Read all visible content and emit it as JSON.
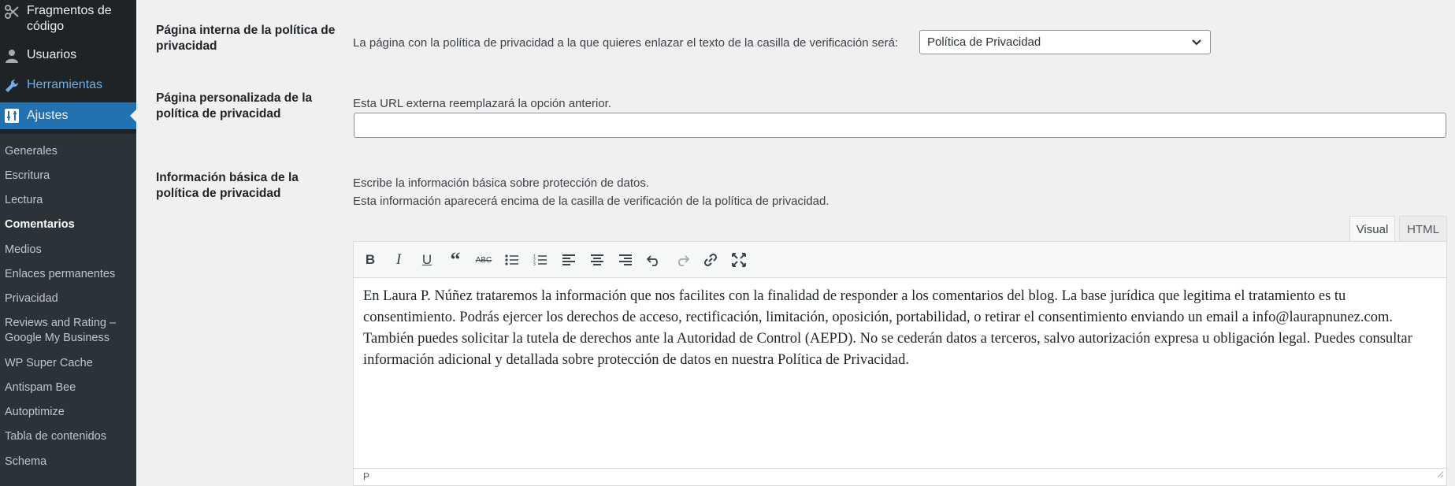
{
  "sidebar": {
    "menu": [
      {
        "label": "Fragmentos de código",
        "icon": "scissors-icon"
      },
      {
        "label": "Usuarios",
        "icon": "user-icon"
      },
      {
        "label": "Herramientas",
        "icon": "wrench-icon"
      },
      {
        "label": "Ajustes",
        "icon": "settings-icon"
      }
    ],
    "submenu": [
      "Generales",
      "Escritura",
      "Lectura",
      "Comentarios",
      "Medios",
      "Enlaces permanentes",
      "Privacidad",
      "Reviews and Rating – Google My Business",
      "WP Super Cache",
      "Antispam Bee",
      "Autoptimize",
      "Tabla de contenidos",
      "Schema"
    ]
  },
  "settings": {
    "internal_page": {
      "label": "Página interna de la política de privacidad",
      "description": "La página con la política de privacidad a la que quieres enlazar el texto de la casilla de verificación será:",
      "selected": "Política de Privacidad"
    },
    "custom_page": {
      "label": "Página personalizada de la política de privacidad",
      "description": "Esta URL externa reemplazará la opción anterior.",
      "value": ""
    },
    "basic_info": {
      "label": "Información básica de la política de privacidad",
      "description_1": "Escribe la información básica sobre protección de datos.",
      "description_2": "Esta información aparecerá encima de la casilla de verificación de la política de privacidad."
    }
  },
  "editor": {
    "tabs": [
      "Visual",
      "HTML"
    ],
    "active_tab": "Visual",
    "toolbar": [
      "bold-icon",
      "italic-icon",
      "underline-icon",
      "blockquote-icon",
      "strikethrough-icon",
      "bullet-list-icon",
      "numbered-list-icon",
      "align-left-icon",
      "align-center-icon",
      "align-right-icon",
      "undo-icon",
      "redo-icon",
      "link-icon",
      "fullscreen-icon"
    ],
    "content": "En Laura P. Núñez trataremos la información que nos facilites con la finalidad de responder a los comentarios del blog. La base jurídica que legitima el tratamiento es tu consentimiento. Podrás ejercer los derechos de acceso, rectificación, limitación, oposición, portabilidad, o retirar el consentimiento enviando un email a info@laurapnunez.com. También puedes solicitar la tutela de derechos ante la Autoridad de Control (AEPD). No se cederán datos a terceros, salvo autorización expresa u obligación legal. Puedes consultar información adicional y detallada sobre protección de datos en nuestra Política de Privacidad.",
    "status_path": "P"
  },
  "colors": {
    "sidebar_bg": "#1d2327",
    "submenu_bg": "#2c3338",
    "accent": "#2271b1",
    "highlight_link": "#72aee6",
    "page_bg": "#f0f0f1"
  }
}
